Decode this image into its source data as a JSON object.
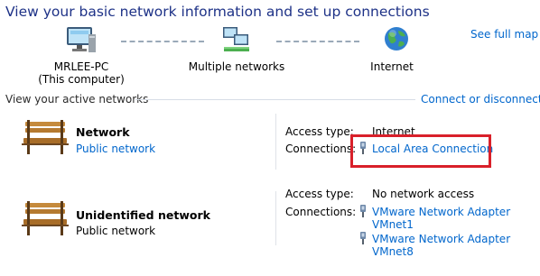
{
  "page": {
    "title": "View your basic network information and set up connections",
    "see_full_map": "See full map"
  },
  "map": {
    "computer": {
      "name": "MRLEE-PC",
      "sub": "(This computer)",
      "icon": "computer-icon"
    },
    "network": {
      "name": "Multiple networks",
      "icon": "network-icon"
    },
    "internet": {
      "name": "Internet",
      "icon": "globe-icon"
    }
  },
  "active": {
    "header": "View your active networks",
    "connect_link": "Connect or disconnect",
    "networks": [
      {
        "name": "Network",
        "category": "Public network",
        "category_is_link": true,
        "access_label": "Access type:",
        "access_value": "Internet",
        "connections_label": "Connections:",
        "connections": [
          "Local Area Connection"
        ],
        "icon": "bench-icon"
      },
      {
        "name": "Unidentified network",
        "category": "Public network",
        "category_is_link": false,
        "access_label": "Access type:",
        "access_value": "No network access",
        "connections_label": "Connections:",
        "connections": [
          {
            "line1": "VMware Network Adapter",
            "line2": "VMnet1"
          },
          {
            "line1": "VMware Network Adapter",
            "line2": "VMnet8"
          }
        ],
        "icon": "bench-icon"
      }
    ]
  },
  "colors": {
    "title": "#1e3287",
    "link": "#0066cc",
    "highlight_box": "#d9202a"
  }
}
